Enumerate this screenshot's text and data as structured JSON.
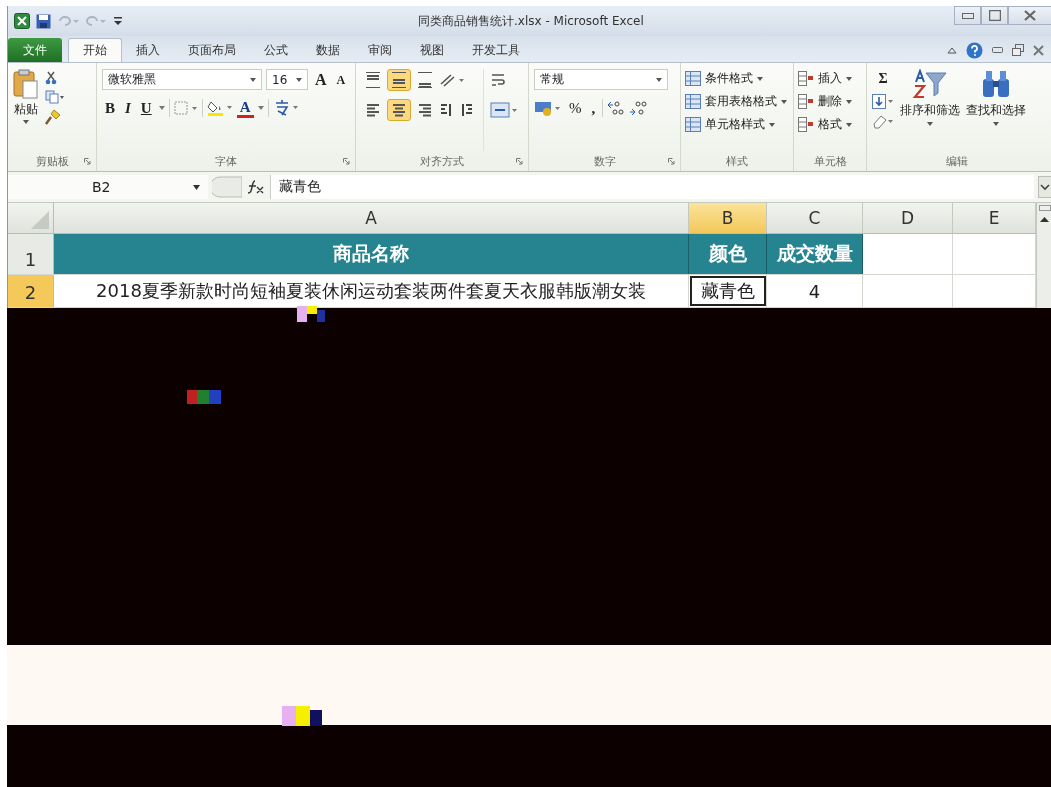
{
  "window": {
    "title": "同类商品销售统计.xlsx - Microsoft Excel"
  },
  "tabs": [
    {
      "label": "文件",
      "kind": "file",
      "selected": false
    },
    {
      "label": "开始",
      "kind": "tab",
      "selected": true
    },
    {
      "label": "插入",
      "kind": "tab",
      "selected": false
    },
    {
      "label": "页面布局",
      "kind": "tab",
      "selected": false
    },
    {
      "label": "公式",
      "kind": "tab",
      "selected": false
    },
    {
      "label": "数据",
      "kind": "tab",
      "selected": false
    },
    {
      "label": "审阅",
      "kind": "tab",
      "selected": false
    },
    {
      "label": "视图",
      "kind": "tab",
      "selected": false
    },
    {
      "label": "开发工具",
      "kind": "tab",
      "selected": false
    }
  ],
  "ribbon": {
    "clipboard": {
      "paste": "粘贴",
      "label": "剪贴板"
    },
    "font": {
      "name": "微软雅黑",
      "size": "16",
      "grow": "A",
      "shrink": "A",
      "bold": "B",
      "italic": "I",
      "underline": "U",
      "font_color": "A",
      "label": "字体"
    },
    "alignment": {
      "buttons": [
        {
          "kind": "top",
          "selected": false
        },
        {
          "kind": "middle",
          "selected": true
        },
        {
          "kind": "bottom",
          "selected": false
        },
        {
          "kind": "left",
          "selected": false
        },
        {
          "kind": "center",
          "selected": true
        },
        {
          "kind": "right",
          "selected": false
        }
      ],
      "label": "对齐方式"
    },
    "number": {
      "format": "常规",
      "percent": "%",
      "comma": ",",
      "label": "数字"
    },
    "styles": {
      "items": [
        "条件格式",
        "套用表格格式",
        "单元格样式"
      ],
      "label": "样式"
    },
    "cells": {
      "items": [
        "插入",
        "删除",
        "格式"
      ],
      "label": "单元格"
    },
    "editing": {
      "sum": "Σ",
      "sort": "排序和筛选",
      "find": "查找和选择",
      "label": "编辑"
    }
  },
  "formula_bar": {
    "name_box": "B2",
    "value": "藏青色"
  },
  "sheet": {
    "columns": [
      {
        "label": "A",
        "selected": false
      },
      {
        "label": "B",
        "selected": true
      },
      {
        "label": "C",
        "selected": false
      },
      {
        "label": "D",
        "selected": false
      },
      {
        "label": "E",
        "selected": false
      }
    ],
    "rows": [
      {
        "number": "1",
        "kind": "header",
        "selected": false,
        "cells": [
          {
            "text": "商品名称",
            "active": false
          },
          {
            "text": "颜色",
            "active": false
          },
          {
            "text": "成交数量",
            "active": false
          }
        ]
      },
      {
        "number": "2",
        "kind": "data",
        "selected": true,
        "cells": [
          {
            "text": "2018夏季新款时尚短袖夏装休闲运动套装两件套夏天衣服韩版潮女装",
            "active": false
          },
          {
            "text": "藏青色",
            "active": true
          },
          {
            "text": "4",
            "active": false
          }
        ]
      }
    ]
  }
}
